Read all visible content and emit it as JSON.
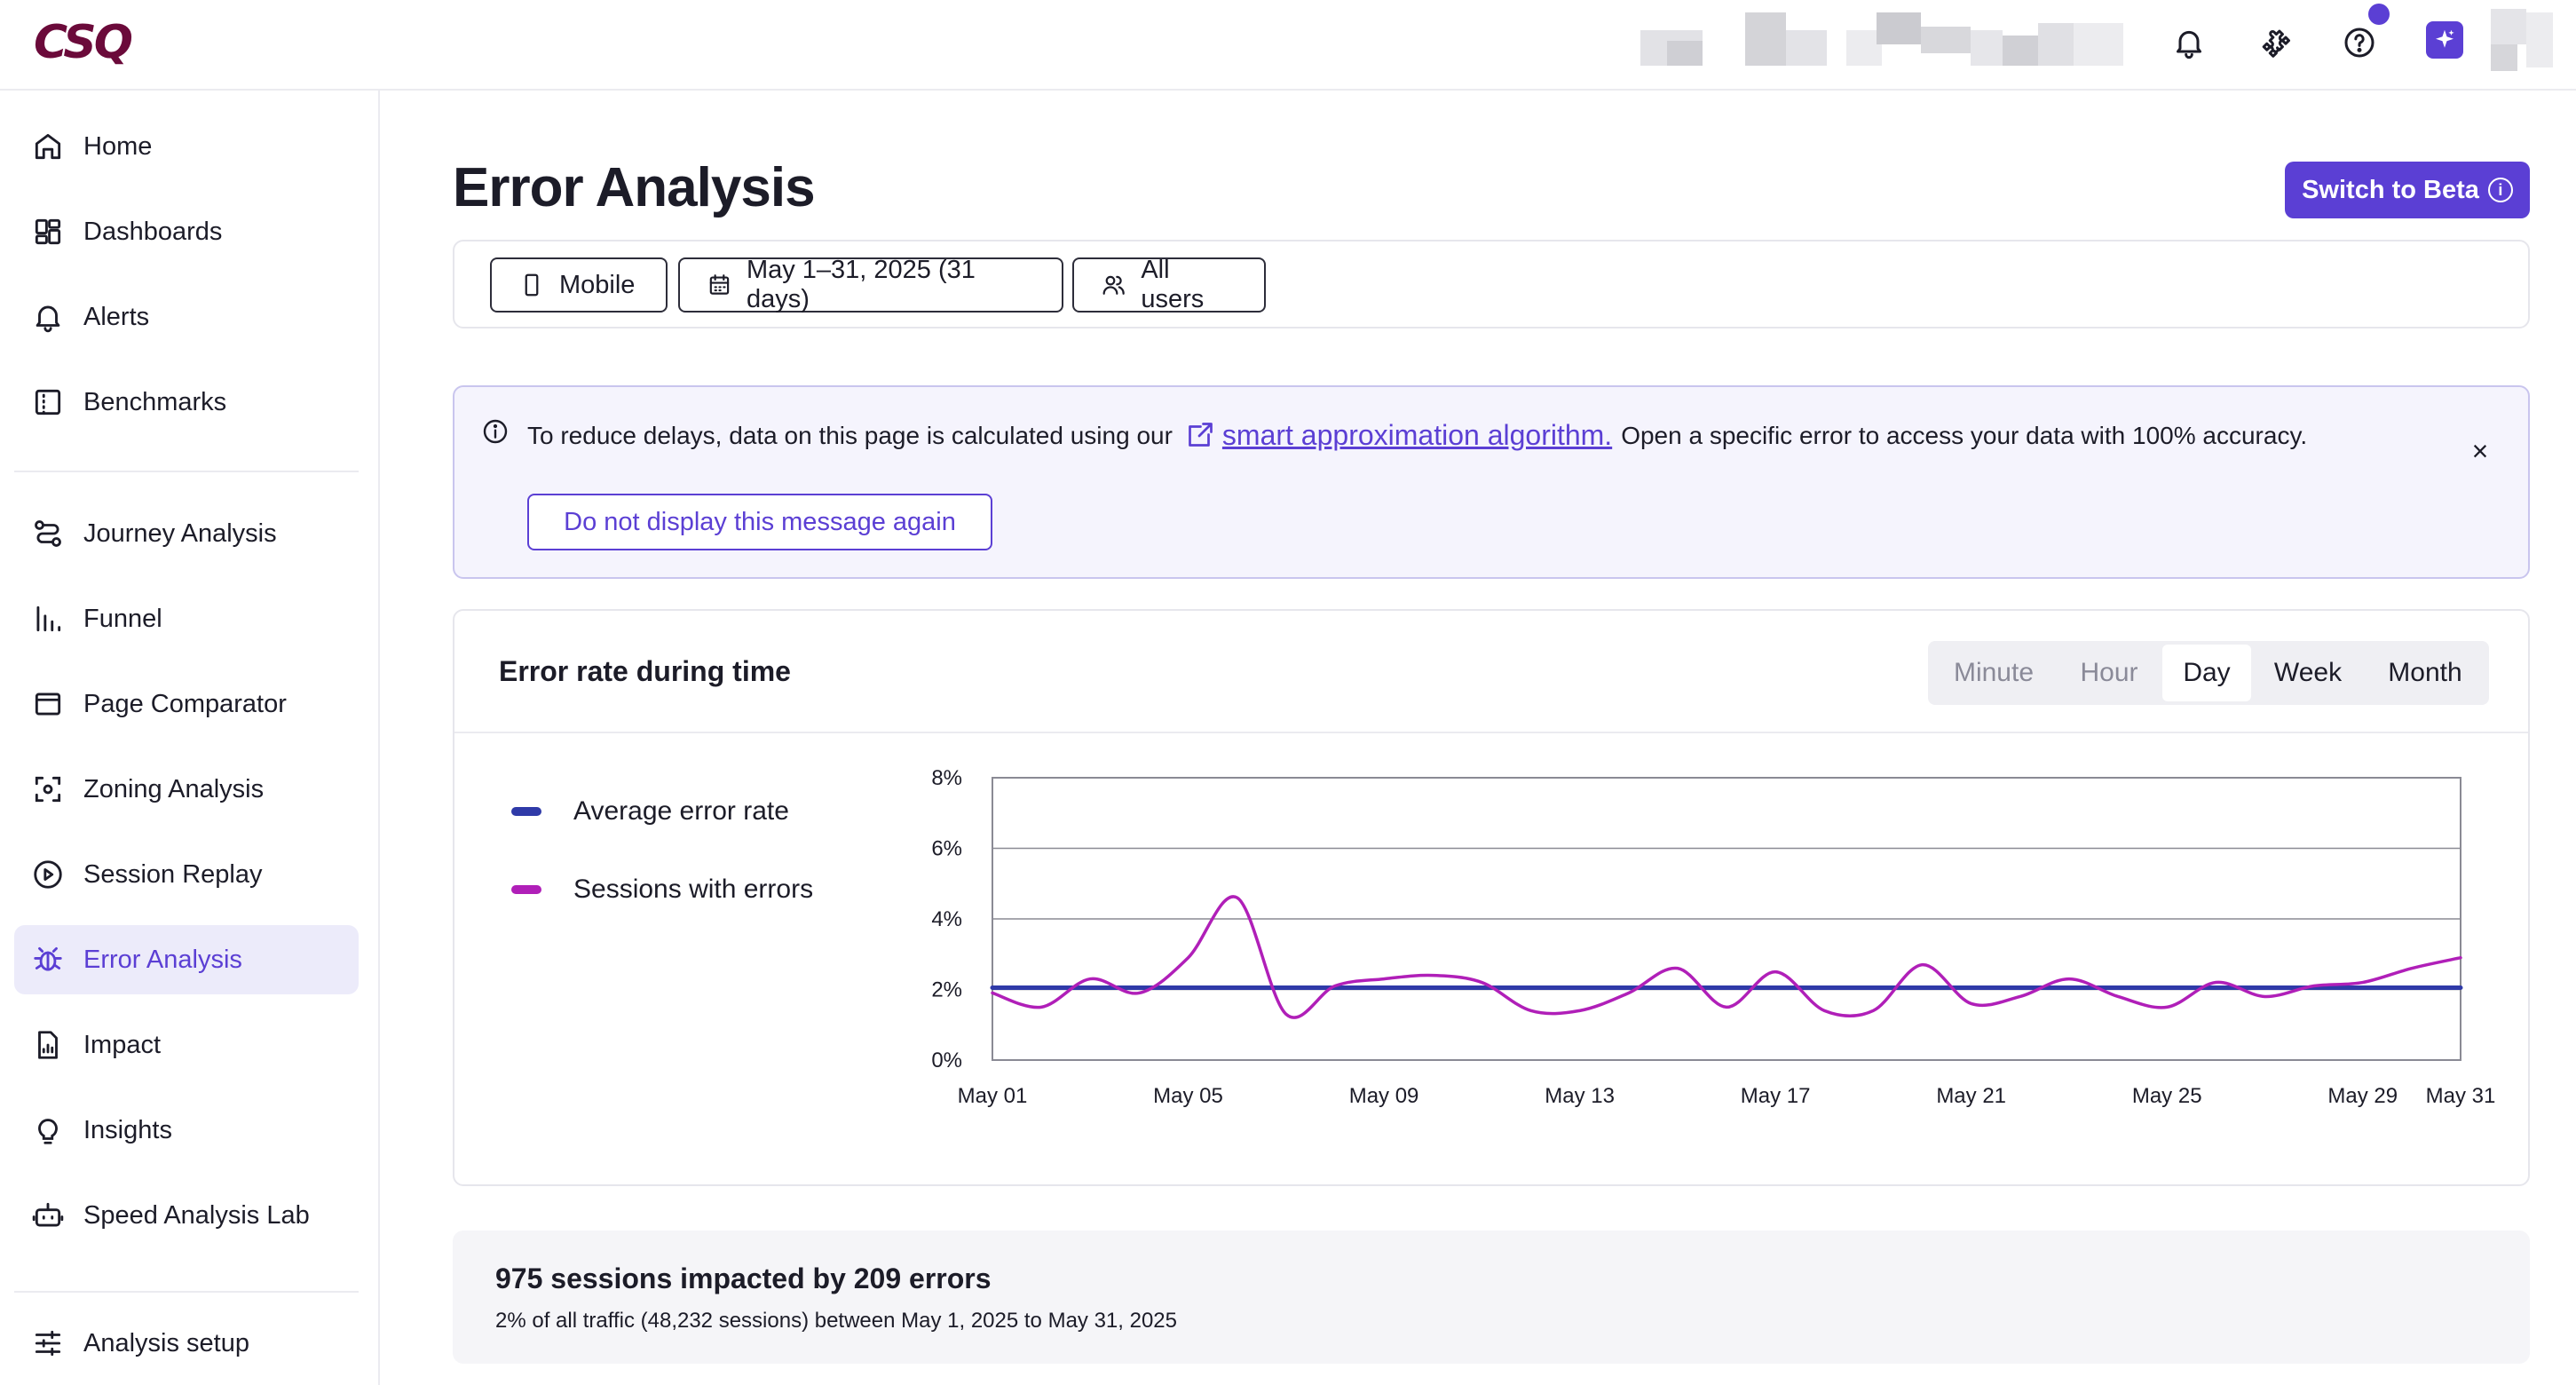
{
  "brand": {
    "logo_text": "CSQ",
    "accent": "#5b3fd4",
    "logo_color": "#6b0a3a"
  },
  "topbar": {
    "icons": [
      "bell-icon",
      "puzzle-icon",
      "help-icon",
      "sparkle-icon",
      "avatar"
    ]
  },
  "sidebar": {
    "items": [
      {
        "label": "Home",
        "icon": "home-icon"
      },
      {
        "label": "Dashboards",
        "icon": "dashboard-icon"
      },
      {
        "label": "Alerts",
        "icon": "bell-icon"
      },
      {
        "label": "Benchmarks",
        "icon": "benchmark-icon"
      },
      {
        "label": "Journey Analysis",
        "icon": "journey-icon"
      },
      {
        "label": "Funnel",
        "icon": "funnel-icon"
      },
      {
        "label": "Page Comparator",
        "icon": "page-comparator-icon"
      },
      {
        "label": "Zoning Analysis",
        "icon": "zoning-icon"
      },
      {
        "label": "Session Replay",
        "icon": "play-icon"
      },
      {
        "label": "Error Analysis",
        "icon": "bug-icon",
        "active": true
      },
      {
        "label": "Impact",
        "icon": "impact-icon"
      },
      {
        "label": "Insights",
        "icon": "lightbulb-icon"
      },
      {
        "label": "Speed Analysis Lab",
        "icon": "robot-icon"
      },
      {
        "label": "Analysis setup",
        "icon": "sliders-icon"
      }
    ]
  },
  "main": {
    "title": "Error Analysis",
    "beta_button": "Switch to Beta",
    "filters": {
      "device": "Mobile",
      "date_range": "May 1–31, 2025 (31 days)",
      "segment": "All users"
    },
    "notice": {
      "text_before": "To reduce delays, data on this page is calculated using our",
      "link": "smart approximation algorithm.",
      "text_after": "Open a specific error to access your data with 100% accuracy.",
      "dismiss_button": "Do not display this message again",
      "close": "×"
    },
    "chart_card": {
      "title": "Error rate during time",
      "granularity": [
        {
          "label": "Minute",
          "state": "disabled"
        },
        {
          "label": "Hour",
          "state": "disabled"
        },
        {
          "label": "Day",
          "state": "selected"
        },
        {
          "label": "Week",
          "state": "enabled"
        },
        {
          "label": "Month",
          "state": "enabled"
        }
      ]
    },
    "summary": {
      "title": "975 sessions impacted by 209 errors",
      "subtitle": "2% of all traffic (48,232 sessions) between May 1, 2025 to May 31, 2025"
    }
  },
  "chart_data": {
    "type": "line",
    "title": "Error rate during time",
    "x": [
      "May 01",
      "May 02",
      "May 03",
      "May 04",
      "May 05",
      "May 06",
      "May 07",
      "May 08",
      "May 09",
      "May 10",
      "May 11",
      "May 12",
      "May 13",
      "May 14",
      "May 15",
      "May 16",
      "May 17",
      "May 18",
      "May 19",
      "May 20",
      "May 21",
      "May 22",
      "May 23",
      "May 24",
      "May 25",
      "May 26",
      "May 27",
      "May 28",
      "May 29",
      "May 30",
      "May 31"
    ],
    "x_ticks": [
      "May 01",
      "May 05",
      "May 09",
      "May 13",
      "May 17",
      "May 21",
      "May 25",
      "May 29",
      "May 31"
    ],
    "y_ticks": [
      "0%",
      "2%",
      "4%",
      "6%",
      "8%"
    ],
    "ylim": [
      0,
      8
    ],
    "grid": true,
    "legend_position": "left",
    "series": [
      {
        "name": "Average error rate",
        "color": "#2f3aa8",
        "values": [
          2.05,
          2.05,
          2.05,
          2.05,
          2.05,
          2.05,
          2.05,
          2.05,
          2.05,
          2.05,
          2.05,
          2.05,
          2.05,
          2.05,
          2.05,
          2.05,
          2.05,
          2.05,
          2.05,
          2.05,
          2.05,
          2.05,
          2.05,
          2.05,
          2.05,
          2.05,
          2.05,
          2.05,
          2.05,
          2.05,
          2.05
        ]
      },
      {
        "name": "Sessions with errors",
        "color": "#b01fb8",
        "values": [
          1.9,
          1.5,
          2.3,
          1.9,
          2.9,
          4.6,
          1.3,
          2.1,
          2.3,
          2.4,
          2.2,
          1.4,
          1.4,
          1.9,
          2.6,
          1.5,
          2.5,
          1.4,
          1.4,
          2.7,
          1.6,
          1.8,
          2.3,
          1.8,
          1.5,
          2.2,
          1.8,
          2.1,
          2.2,
          2.6,
          2.9
        ]
      }
    ]
  }
}
